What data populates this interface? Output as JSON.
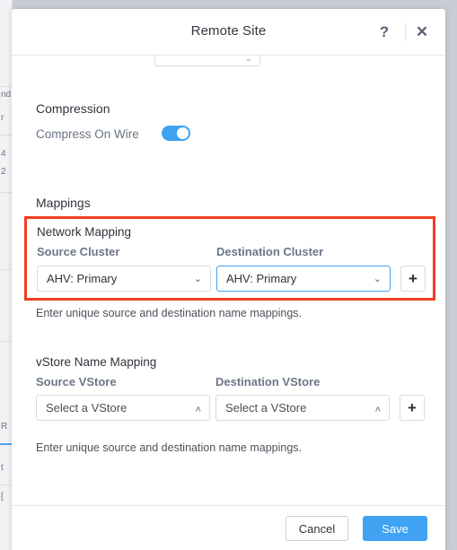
{
  "window": {
    "title": "Remote Site",
    "help_icon": "help-icon",
    "close_icon": "close-icon",
    "help_glyph": "?",
    "close_glyph": "✕"
  },
  "clipped_control": {
    "value": "",
    "chevron": "⌄"
  },
  "compression": {
    "section_title": "Compression",
    "toggle_label": "Compress On Wire",
    "toggle_state": "on"
  },
  "mappings": {
    "section_title": "Mappings",
    "network_mapping": {
      "subtitle": "Network Mapping",
      "source_label": "Source Cluster",
      "destination_label": "Destination Cluster",
      "source_value": "AHV: Primary",
      "destination_value": "AHV: Primary",
      "source_chevron": "⌄",
      "destination_chevron": "⌄",
      "add_label": "+",
      "hint": "Enter unique source and destination name mappings.",
      "highlighted": true,
      "highlight_color": "#f03d20",
      "focused_field": "destination"
    },
    "vstore_mapping": {
      "subtitle": "vStore Name Mapping",
      "source_label": "Source VStore",
      "destination_label": "Destination VStore",
      "source_value": "Select a VStore",
      "destination_value": "Select a VStore",
      "source_chevron": "˄",
      "destination_chevron": "˄",
      "add_label": "+",
      "hint": "Enter unique source and destination name mappings."
    }
  },
  "footer": {
    "cancel_label": "Cancel",
    "save_label": "Save"
  },
  "colors": {
    "accent": "#3fa2f2",
    "highlight": "#f03d20",
    "page_background": "#c9ccd3"
  }
}
